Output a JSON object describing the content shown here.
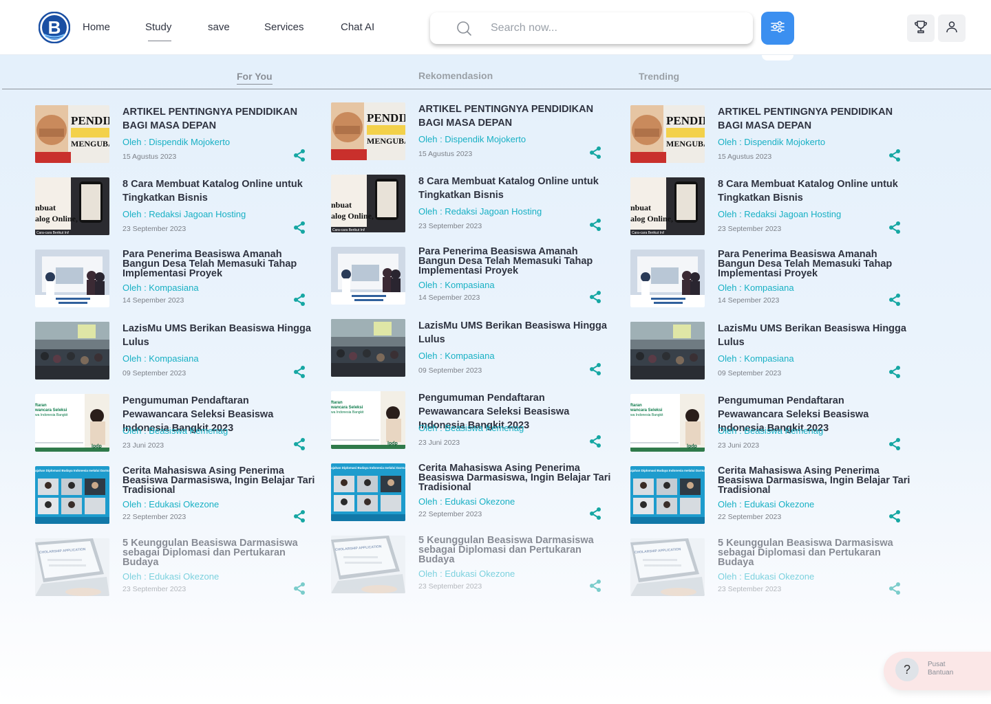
{
  "nav": {
    "home": "Home",
    "study": "Study",
    "save": "save",
    "services": "Services",
    "chat": "Chat AI"
  },
  "search": {
    "placeholder": "Search now..."
  },
  "tabs": {
    "for_you": "For You",
    "rekomendasi": "Rekomendasion",
    "trending": "Trending"
  },
  "articles": [
    {
      "title": "ARTIKEL PENTINGNYA PENDIDIKAN BAGI MASA DEPAN",
      "author": "Oleh : Dispendik Mojokerto",
      "date": "15 Agustus 2023",
      "thumb": "pendidikan"
    },
    {
      "title": "8 Cara Membuat Katalog Online untuk Tingkatkan Bisnis",
      "author": "Oleh : Redaksi Jagoan Hosting",
      "date": "23 September 2023",
      "thumb": "katalog"
    },
    {
      "title": "Para Penerima Beasiswa Amanah Bangun Desa Telah Memasuki Tahap Implementasi Proyek",
      "author": "Oleh : Kompasiana",
      "date": "14 Sepember 2023",
      "thumb": "amanah"
    },
    {
      "title": "LazisMu UMS Berikan Beasiswa Hingga Lulus",
      "author": "Oleh : Kompasiana",
      "date": "09 September 2023",
      "thumb": "lazismu"
    },
    {
      "title": "Pengumuman Pendaftaran Pewawancara Seleksi Beasiswa Indonesia Bangkit 2023",
      "author": "Oleh : Beasiswa Kemenag",
      "date": "23 Juni 2023",
      "thumb": "pengumuman"
    },
    {
      "title": "Cerita Mahasiswa Asing Penerima Beasiswa Darmasiswa, Ingin Belajar Tari Tradisional",
      "author": "Oleh : Edukasi Okezone",
      "date": "22 September 2023",
      "thumb": "cerita"
    },
    {
      "title": "5 Keunggulan Beasiswa Darmasiswa sebagai Diplomasi dan Pertukaran Budaya",
      "author": "Oleh : Edukasi Okezone",
      "date": "23 September 2023",
      "thumb": "keunggulan"
    }
  ],
  "thumb_text": {
    "pendidikan_big": "PENDIDIK",
    "pendidikan_mid": "MENGUBAH D",
    "katalog_1": "nbuat",
    "katalog_2": "alog Online,",
    "katalog_3": "Cara-cara Berikut Ini!",
    "pengumuman_1": "ftaran",
    "pengumuman_2": "wancara Seleksi",
    "pengumuman_3": "wa Indonesia Bangkit",
    "pengumuman_logo": "lpdp",
    "cerita_banner": "Penjelajahan Diplomasi Budaya Indonesia melalui Darmasiswa",
    "keunggulan_text": "CHOLARSHIP APPLICATION"
  },
  "help": {
    "line1": "Pusat",
    "line2": "Bantuan"
  },
  "colors": {
    "accent": "#3b8ff0",
    "author": "#17b0c4",
    "share": "#16a7a3",
    "background": "#e4f0fb"
  }
}
